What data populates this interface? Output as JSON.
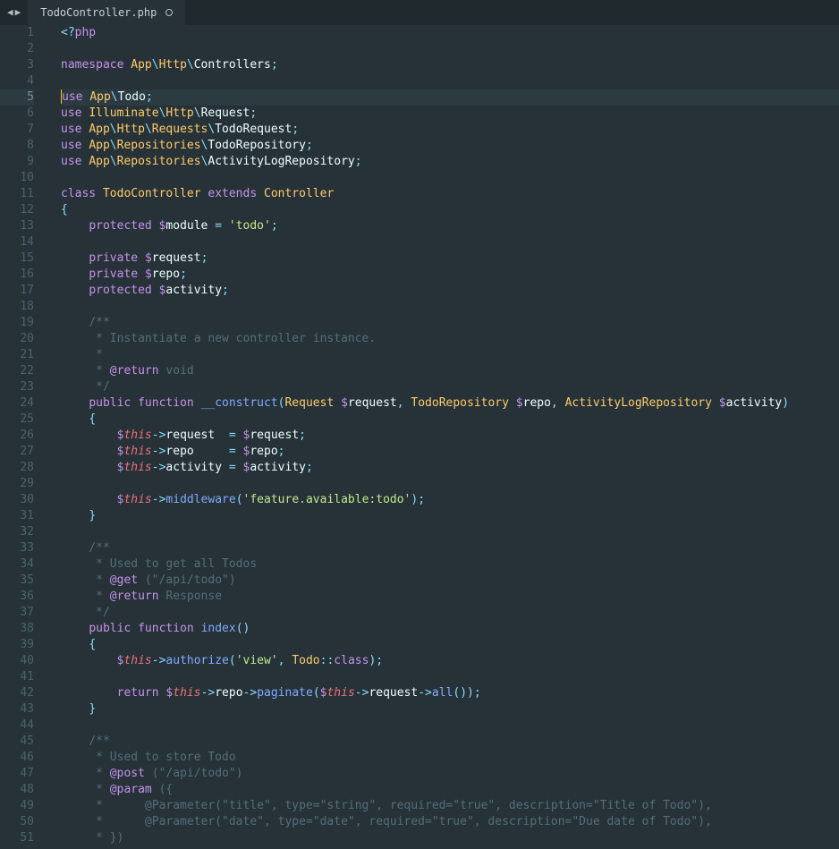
{
  "tab": {
    "filename": "TodoController.php",
    "dirty": true
  },
  "nav": {
    "back": "◀",
    "fwd": "▶"
  },
  "lines": [
    {
      "n": 1,
      "html": "<span class='c-tag'>&lt;?</span><span class='c-kw'>php</span>"
    },
    {
      "n": 2,
      "html": ""
    },
    {
      "n": 3,
      "html": "<span class='c-kw'>namespace</span> <span class='c-ns'>App</span><span class='c-punc'>\\</span><span class='c-ns'>Http</span><span class='c-punc'>\\</span><span class='c-text'>Controllers</span><span class='c-punc'>;</span>"
    },
    {
      "n": 4,
      "html": ""
    },
    {
      "n": 5,
      "hl": true,
      "html": "<span class='cursor'></span><span class='c-kw'>use</span> <span class='c-ns'>App</span><span class='c-punc'>\\</span><span class='c-text'>Todo</span><span class='c-punc'>;</span>"
    },
    {
      "n": 6,
      "html": "<span class='c-kw'>use</span> <span class='c-ns'>Illuminate</span><span class='c-punc'>\\</span><span class='c-ns'>Http</span><span class='c-punc'>\\</span><span class='c-text'>Request</span><span class='c-punc'>;</span>"
    },
    {
      "n": 7,
      "html": "<span class='c-kw'>use</span> <span class='c-ns'>App</span><span class='c-punc'>\\</span><span class='c-ns'>Http</span><span class='c-punc'>\\</span><span class='c-ns'>Requests</span><span class='c-punc'>\\</span><span class='c-text'>TodoRequest</span><span class='c-punc'>;</span>"
    },
    {
      "n": 8,
      "html": "<span class='c-kw'>use</span> <span class='c-ns'>App</span><span class='c-punc'>\\</span><span class='c-ns'>Repositories</span><span class='c-punc'>\\</span><span class='c-text'>TodoRepository</span><span class='c-punc'>;</span>"
    },
    {
      "n": 9,
      "html": "<span class='c-kw'>use</span> <span class='c-ns'>App</span><span class='c-punc'>\\</span><span class='c-ns'>Repositories</span><span class='c-punc'>\\</span><span class='c-text'>ActivityLogRepository</span><span class='c-punc'>;</span>"
    },
    {
      "n": 10,
      "html": ""
    },
    {
      "n": 11,
      "html": "<span class='c-kw'>class</span> <span class='c-ns'>TodoController</span> <span class='c-kw'>extends</span> <span class='c-ns'>Controller</span>"
    },
    {
      "n": 12,
      "html": "<span class='c-punc'>{</span>"
    },
    {
      "n": 13,
      "html": "    <span class='c-kw'>protected</span> <span class='c-dol'>$</span><span class='c-text'>module</span> <span class='c-punc'>=</span> <span class='c-str'>'todo'</span><span class='c-punc'>;</span>"
    },
    {
      "n": 14,
      "html": ""
    },
    {
      "n": 15,
      "html": "    <span class='c-kw'>private</span> <span class='c-dol'>$</span><span class='c-text'>request</span><span class='c-punc'>;</span>"
    },
    {
      "n": 16,
      "html": "    <span class='c-kw'>private</span> <span class='c-dol'>$</span><span class='c-text'>repo</span><span class='c-punc'>;</span>"
    },
    {
      "n": 17,
      "html": "    <span class='c-kw'>protected</span> <span class='c-dol'>$</span><span class='c-text'>activity</span><span class='c-punc'>;</span>"
    },
    {
      "n": 18,
      "html": ""
    },
    {
      "n": 19,
      "html": "    <span class='c-com'>/**</span>"
    },
    {
      "n": 20,
      "html": "<span class='c-com'>     * Instantiate a new controller instance.</span>"
    },
    {
      "n": 21,
      "html": "<span class='c-com'>     *</span>"
    },
    {
      "n": 22,
      "html": "<span class='c-com'>     * </span><span class='c-docat'>@return</span><span class='c-com'> void</span>"
    },
    {
      "n": 23,
      "html": "<span class='c-com'>     */</span>"
    },
    {
      "n": 24,
      "html": "    <span class='c-kw'>public</span> <span class='c-kw'>function</span> <span class='c-func'>__construct</span><span class='c-punc'>(</span><span class='c-type'>Request</span> <span class='c-dol'>$</span><span class='c-text'>request</span><span class='c-punc'>,</span> <span class='c-type'>TodoRepository</span> <span class='c-dol'>$</span><span class='c-text'>repo</span><span class='c-punc'>,</span> <span class='c-type'>ActivityLogRepository</span> <span class='c-dol'>$</span><span class='c-text'>activity</span><span class='c-punc'>)</span>"
    },
    {
      "n": 25,
      "html": "    <span class='c-punc'>{</span>"
    },
    {
      "n": 26,
      "html": "        <span class='c-dol'>$</span><span class='c-this'>this</span><span class='c-punc'>-&gt;</span><span class='c-text'>request</span>  <span class='c-punc'>=</span> <span class='c-dol'>$</span><span class='c-text'>request</span><span class='c-punc'>;</span>"
    },
    {
      "n": 27,
      "html": "        <span class='c-dol'>$</span><span class='c-this'>this</span><span class='c-punc'>-&gt;</span><span class='c-text'>repo</span>     <span class='c-punc'>=</span> <span class='c-dol'>$</span><span class='c-text'>repo</span><span class='c-punc'>;</span>"
    },
    {
      "n": 28,
      "html": "        <span class='c-dol'>$</span><span class='c-this'>this</span><span class='c-punc'>-&gt;</span><span class='c-text'>activity</span> <span class='c-punc'>=</span> <span class='c-dol'>$</span><span class='c-text'>activity</span><span class='c-punc'>;</span>"
    },
    {
      "n": 29,
      "html": ""
    },
    {
      "n": 30,
      "html": "        <span class='c-dol'>$</span><span class='c-this'>this</span><span class='c-punc'>-&gt;</span><span class='c-func'>middleware</span><span class='c-punc'>(</span><span class='c-str'>'feature.available:todo'</span><span class='c-punc'>);</span>"
    },
    {
      "n": 31,
      "html": "    <span class='c-punc'>}</span>"
    },
    {
      "n": 32,
      "html": ""
    },
    {
      "n": 33,
      "html": "    <span class='c-com'>/**</span>"
    },
    {
      "n": 34,
      "html": "<span class='c-com'>     * Used to get all Todos</span>"
    },
    {
      "n": 35,
      "html": "<span class='c-com'>     * </span><span class='c-docat'>@get</span><span class='c-com'> (\"/api/todo\")</span>"
    },
    {
      "n": 36,
      "html": "<span class='c-com'>     * </span><span class='c-docat'>@return</span><span class='c-com'> Response</span>"
    },
    {
      "n": 37,
      "html": "<span class='c-com'>     */</span>"
    },
    {
      "n": 38,
      "html": "    <span class='c-kw'>public</span> <span class='c-kw'>function</span> <span class='c-func'>index</span><span class='c-punc'>()</span>"
    },
    {
      "n": 39,
      "html": "    <span class='c-punc'>{</span>"
    },
    {
      "n": 40,
      "html": "        <span class='c-dol'>$</span><span class='c-this'>this</span><span class='c-punc'>-&gt;</span><span class='c-func'>authorize</span><span class='c-punc'>(</span><span class='c-str'>'view'</span><span class='c-punc'>,</span> <span class='c-type'>Todo</span><span class='c-punc'>::</span><span class='c-kw'>class</span><span class='c-punc'>);</span>"
    },
    {
      "n": 41,
      "html": ""
    },
    {
      "n": 42,
      "html": "        <span class='c-kw'>return</span> <span class='c-dol'>$</span><span class='c-this'>this</span><span class='c-punc'>-&gt;</span><span class='c-text'>repo</span><span class='c-punc'>-&gt;</span><span class='c-func'>paginate</span><span class='c-punc'>(</span><span class='c-dol'>$</span><span class='c-this'>this</span><span class='c-punc'>-&gt;</span><span class='c-text'>request</span><span class='c-punc'>-&gt;</span><span class='c-func'>all</span><span class='c-punc'>());</span>"
    },
    {
      "n": 43,
      "html": "    <span class='c-punc'>}</span>"
    },
    {
      "n": 44,
      "html": ""
    },
    {
      "n": 45,
      "html": "    <span class='c-com'>/**</span>"
    },
    {
      "n": 46,
      "html": "<span class='c-com'>     * Used to store Todo</span>"
    },
    {
      "n": 47,
      "html": "<span class='c-com'>     * </span><span class='c-docat'>@post</span><span class='c-com'> (\"/api/todo\")</span>"
    },
    {
      "n": 48,
      "html": "<span class='c-com'>     * </span><span class='c-docat'>@param</span><span class='c-com'> ({</span>"
    },
    {
      "n": 49,
      "html": "<span class='c-com'>     *      @Parameter(\"title\", type=\"string\", required=\"true\", description=\"Title of Todo\"),</span>"
    },
    {
      "n": 50,
      "html": "<span class='c-com'>     *      @Parameter(\"date\", type=\"date\", required=\"true\", description=\"Due date of Todo\"),</span>"
    },
    {
      "n": 51,
      "html": "<span class='c-com'>     * })</span>"
    }
  ]
}
